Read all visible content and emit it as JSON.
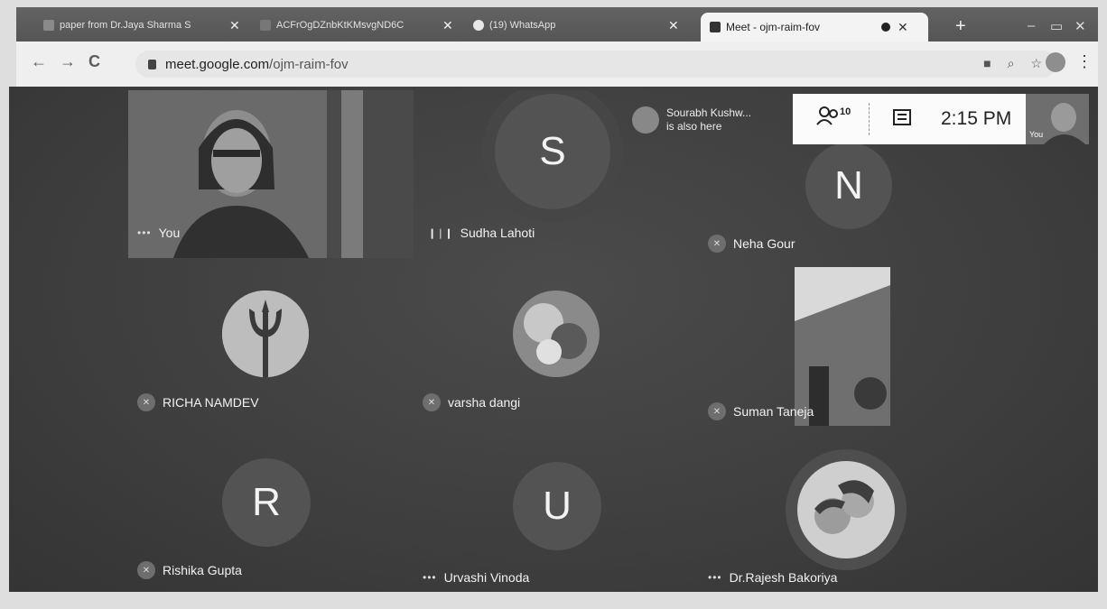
{
  "tabs": [
    {
      "label": "paper from Dr.Jaya Sharma S",
      "active": false
    },
    {
      "label": "ACFrOgDZnbKtKMsvgND6C",
      "active": false
    },
    {
      "label": "(19) WhatsApp",
      "active": false
    },
    {
      "label": "Meet - ojm-raim-fov",
      "active": true
    }
  ],
  "browser": {
    "url_domain": "meet.google.com",
    "url_path": "/ojm-raim-fov",
    "new_tab": "+",
    "minimize": "–",
    "maximize": "▭",
    "close": "✕"
  },
  "meet": {
    "notice_name": "Sourabh Kushw...",
    "notice_text": "is also here",
    "people_count": "10",
    "clock": "2:15 PM",
    "self_view_label": "You"
  },
  "participants": [
    {
      "name": "You",
      "kind": "video",
      "indicator": "dots"
    },
    {
      "name": "Sudha Lahoti",
      "kind": "letter",
      "letter": "S",
      "indicator": "speaking"
    },
    {
      "name": "Neha Gour",
      "kind": "letter",
      "letter": "N",
      "indicator": "muted"
    },
    {
      "name": "RICHA NAMDEV",
      "kind": "photo",
      "indicator": "muted"
    },
    {
      "name": "varsha dangi",
      "kind": "photo",
      "indicator": "muted"
    },
    {
      "name": "Suman Taneja",
      "kind": "video",
      "indicator": "muted"
    },
    {
      "name": "Rishika Gupta",
      "kind": "letter",
      "letter": "R",
      "indicator": "muted"
    },
    {
      "name": "Urvashi Vinoda",
      "kind": "letter",
      "letter": "U",
      "indicator": "dots"
    },
    {
      "name": "Dr.Rajesh Bakoriya",
      "kind": "photo",
      "indicator": "dots"
    }
  ],
  "colors": {
    "stage": "#3f3f3f",
    "avatar_bg": "#535353",
    "tab_strip": "#5b5b5b",
    "panel": "#fbfbfb"
  },
  "icons": {
    "back": "←",
    "forward": "→",
    "reload": "C",
    "muted": "✕",
    "more": "•••",
    "speaking": "❙❘❙",
    "people": "👥",
    "chat": "▤",
    "search": "⌕",
    "star": "☆",
    "kebab": "⋮"
  }
}
